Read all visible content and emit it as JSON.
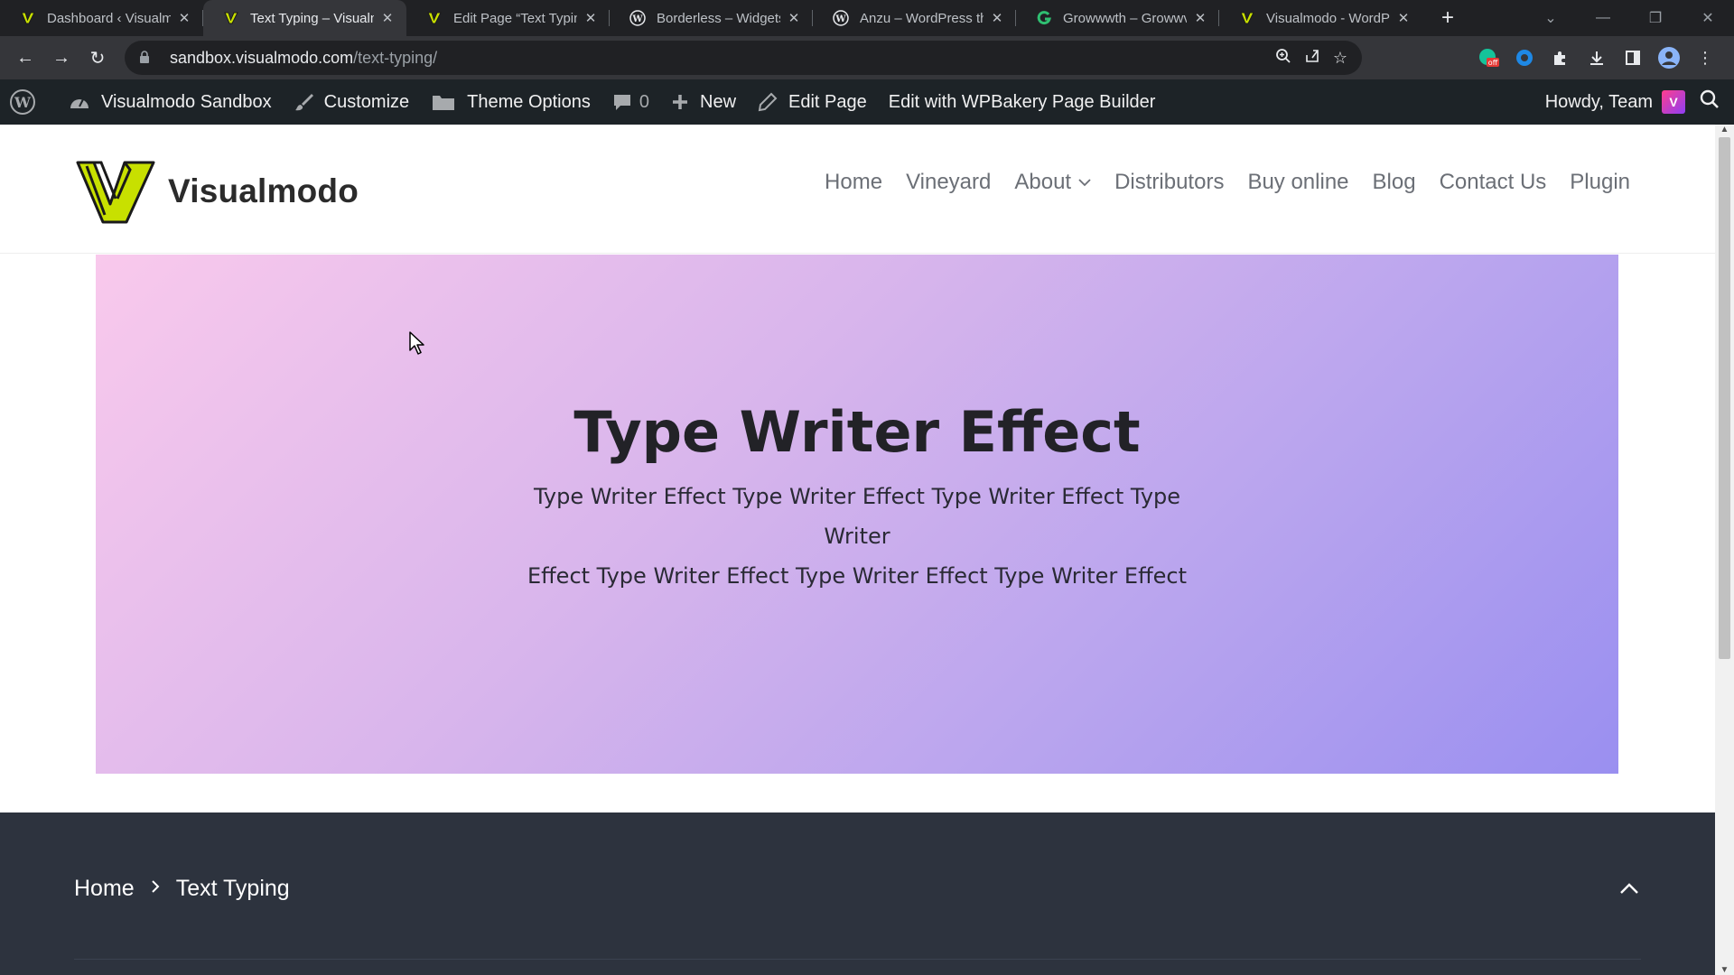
{
  "browser": {
    "tabs": [
      {
        "title": "Dashboard ‹ Visualmo",
        "favicon": "visualmodo-logo-icon",
        "active": false
      },
      {
        "title": "Text Typing – Visualm",
        "favicon": "visualmodo-logo-icon",
        "active": true
      },
      {
        "title": "Edit Page “Text Typing",
        "favicon": "visualmodo-logo-icon",
        "active": false
      },
      {
        "title": "Borderless – Widgets,",
        "favicon": "wordpress-icon",
        "active": false
      },
      {
        "title": "Anzu – WordPress the",
        "favicon": "wordpress-icon",
        "active": false
      },
      {
        "title": "Growwwth – Growwv",
        "favicon": "growwwth-icon",
        "active": false
      },
      {
        "title": "Visualmodo - WordPr",
        "favicon": "visualmodo-logo-icon",
        "active": false
      }
    ],
    "new_tab": "+",
    "url_host": "sandbox.visualmodo.com",
    "url_path": "/text-typing/",
    "extension_badge": "off"
  },
  "wp_admin_bar": {
    "site_name": "Visualmodo Sandbox",
    "customize": "Customize",
    "theme_options": "Theme Options",
    "comments_count": "0",
    "new": "New",
    "edit_page": "Edit Page",
    "wpbakery": "Edit with WPBakery Page Builder",
    "howdy": "Howdy, Team"
  },
  "site": {
    "logo_text": "Visualmodo",
    "nav": {
      "home": "Home",
      "vineyard": "Vineyard",
      "about": "About",
      "distributors": "Distributors",
      "buy_online": "Buy online",
      "blog": "Blog",
      "contact": "Contact Us",
      "plugin": "Plugin"
    }
  },
  "hero": {
    "title": "Type Writer Effect",
    "subtitle_line1": "Type Writer Effect Type Writer Effect Type Writer Effect Type Writer",
    "subtitle_line2": "Effect Type Writer Effect Type Writer Effect Type Writer Effect"
  },
  "footer": {
    "breadcrumb_home": "Home",
    "breadcrumb_current": "Text Typing"
  },
  "colors": {
    "wp_admin_bar": "#1d2327",
    "browser_bg": "#202124",
    "footer_bg": "#2d333e",
    "hero_gradient_start": "#f9c9ec",
    "hero_gradient_end": "#9a8ff0",
    "logo_accent": "#c8e000"
  }
}
